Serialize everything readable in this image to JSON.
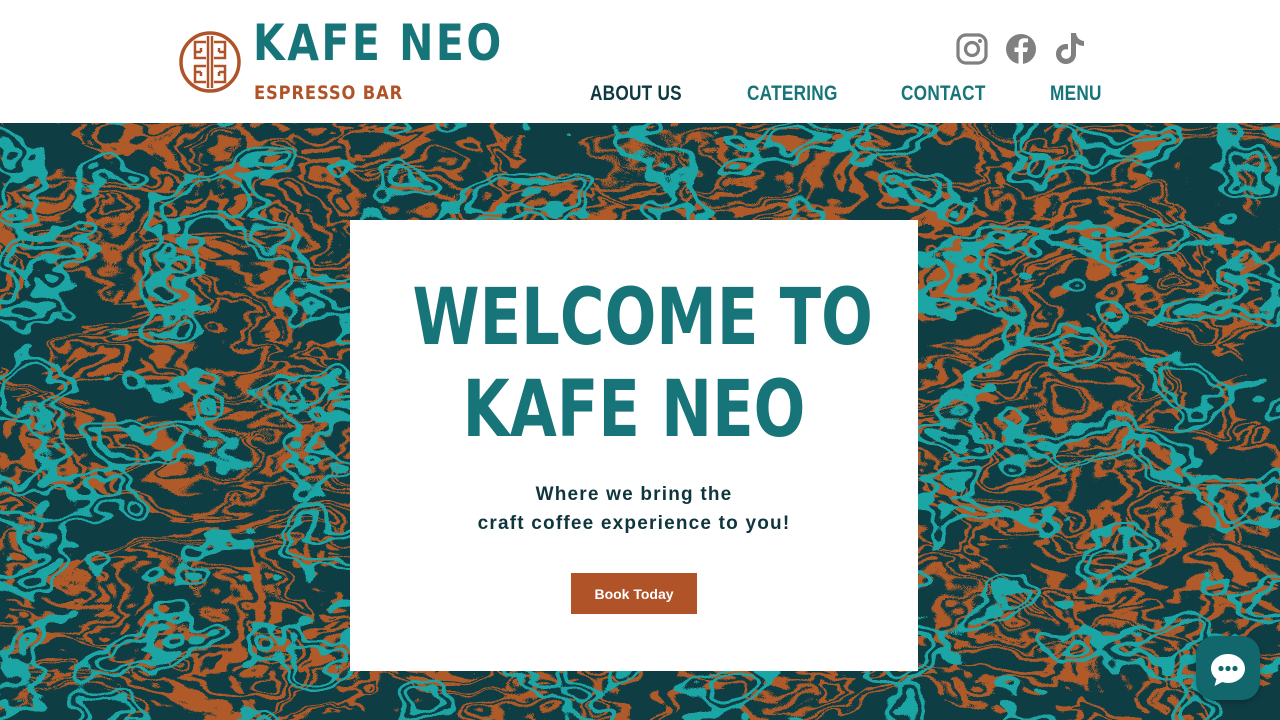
{
  "brand": {
    "name": "KAFE NEO",
    "tagline": "ESPRESSO BAR"
  },
  "social": [
    {
      "icon": "instagram-icon",
      "label": "Instagram"
    },
    {
      "icon": "facebook-icon",
      "label": "Facebook"
    },
    {
      "icon": "tiktok-icon",
      "label": "TikTok"
    }
  ],
  "nav": {
    "items": [
      {
        "label": "ABOUT US",
        "active": true
      },
      {
        "label": "CATERING",
        "active": false
      },
      {
        "label": "CONTACT",
        "active": false
      },
      {
        "label": "MENU",
        "active": false
      }
    ]
  },
  "hero": {
    "title_line1": "WELCOME TO",
    "title_line2": "KAFE NEO",
    "subtitle_line1": "Where we bring the",
    "subtitle_line2": "craft coffee experience to you!",
    "cta_label": "Book Today"
  },
  "chat": {
    "icon": "chat-icon"
  },
  "colors": {
    "teal": "#17757a",
    "dark_teal": "#0f3940",
    "rust": "#b05328",
    "social_gray": "#808080",
    "chat_bg": "#12676c"
  }
}
